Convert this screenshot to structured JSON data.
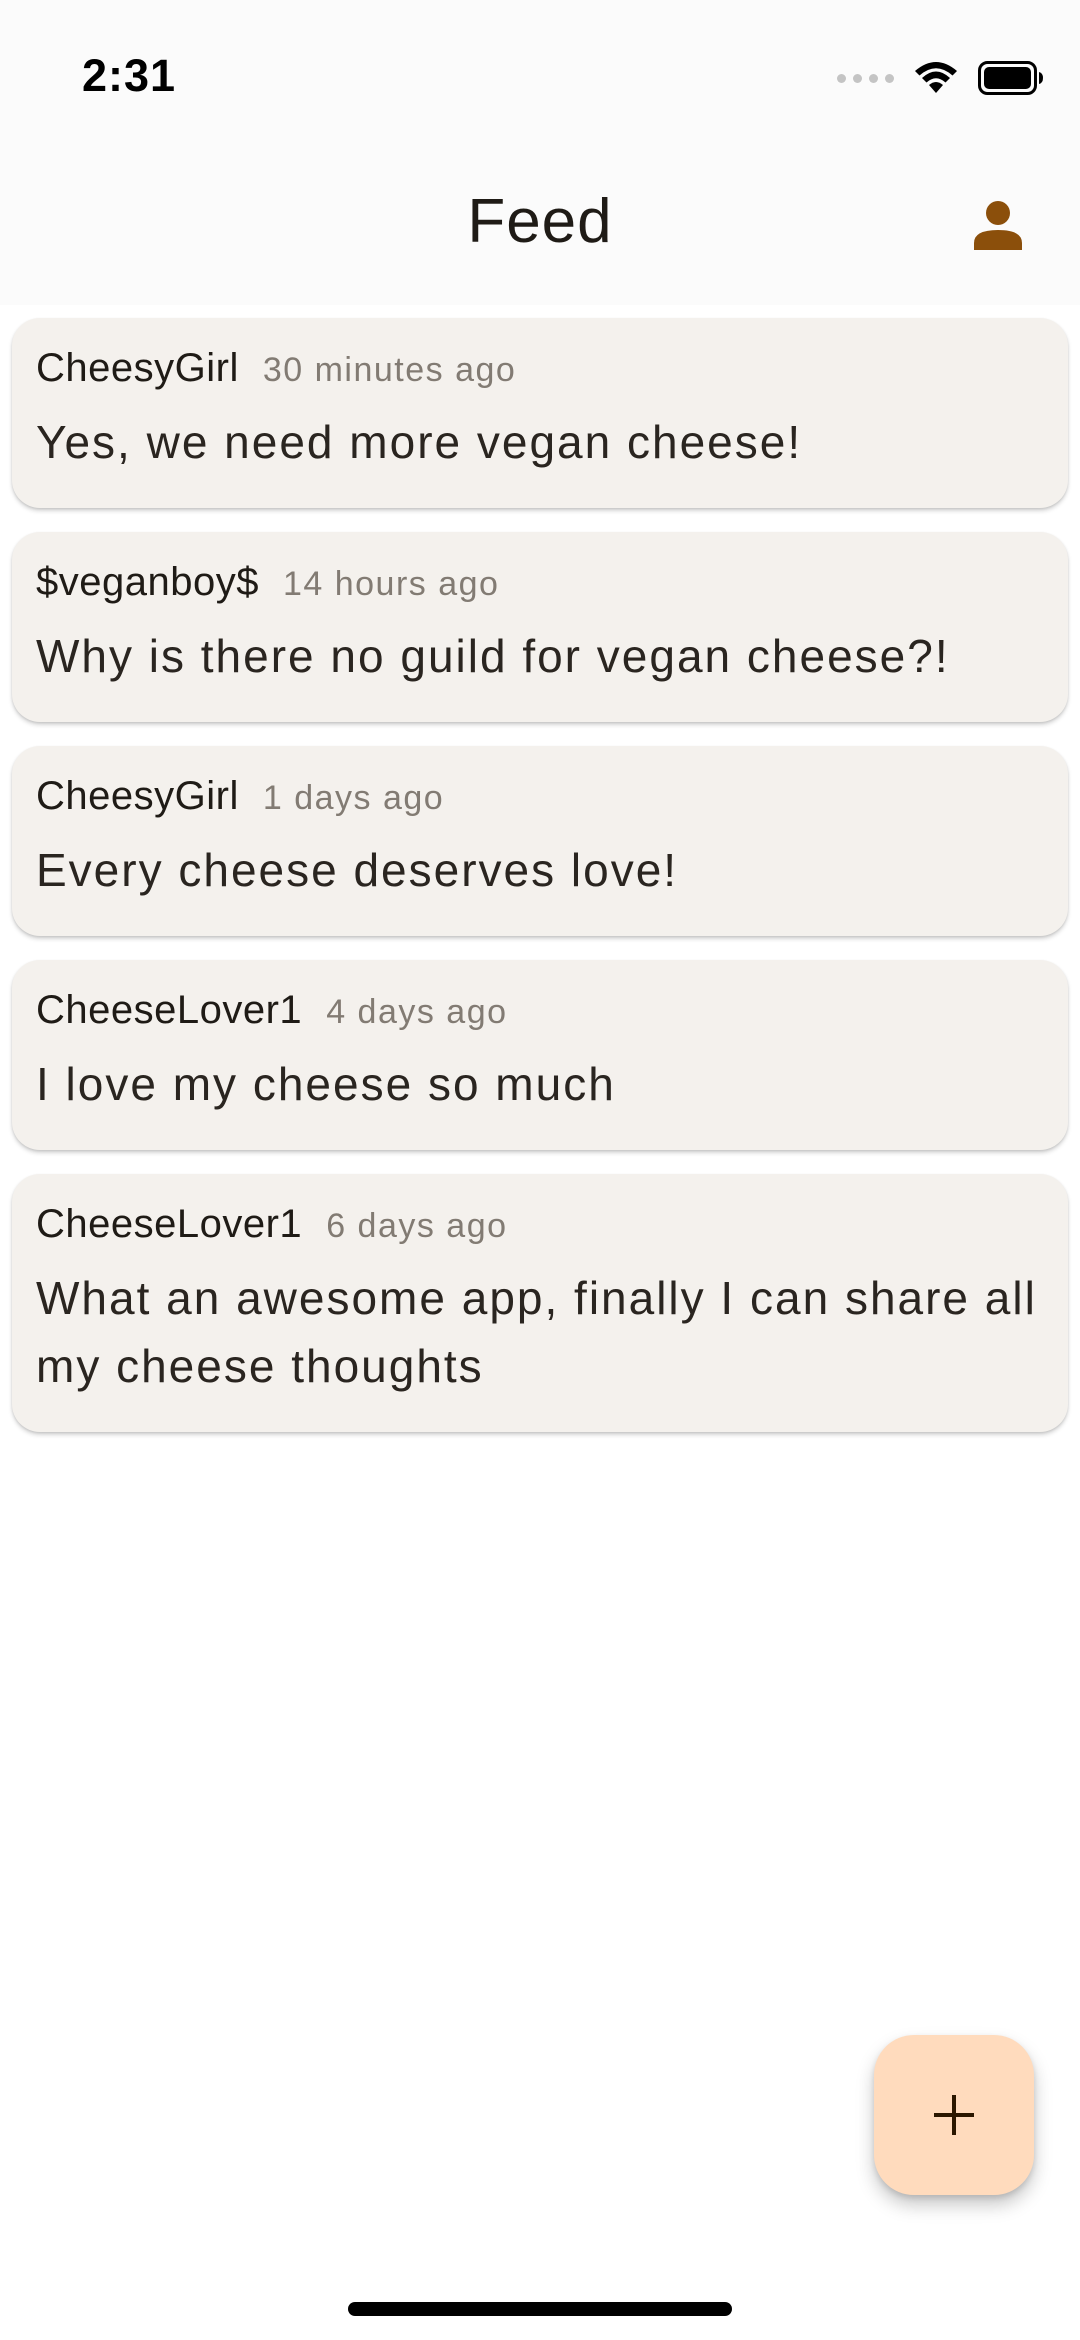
{
  "status_bar": {
    "time": "2:31"
  },
  "app_bar": {
    "title": "Feed",
    "profile_icon": "person-icon"
  },
  "colors": {
    "accent": "#8b4f0b",
    "card_background": "#f4f1ed",
    "fab_background": "#ffdbbd"
  },
  "posts": [
    {
      "author": "CheesyGirl",
      "time": "30 minutes ago",
      "content": "Yes, we need more vegan cheese!"
    },
    {
      "author": "$veganboy$",
      "time": "14 hours ago",
      "content": "Why is there no guild for vegan cheese?!"
    },
    {
      "author": "CheesyGirl",
      "time": "1 days ago",
      "content": "Every cheese deserves love!"
    },
    {
      "author": "CheeseLover1",
      "time": "4 days ago",
      "content": "I love my cheese so much"
    },
    {
      "author": "CheeseLover1",
      "time": "6 days ago",
      "content": "What an awesome app, finally I can share all my cheese thoughts"
    }
  ],
  "fab": {
    "icon": "plus-icon"
  }
}
